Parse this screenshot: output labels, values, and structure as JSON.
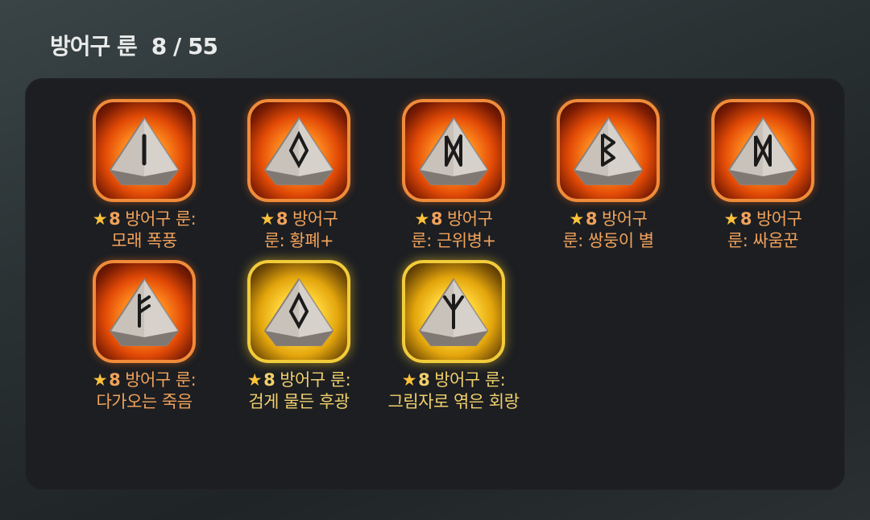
{
  "header": {
    "title": "방어구 룬",
    "count": "8 / 55"
  },
  "runes": [
    {
      "star": "★",
      "grade": "8",
      "name": "방어구 룬:\n모래 폭풍",
      "tier": "orange",
      "glyph": "isa-icon"
    },
    {
      "star": "★",
      "grade": "8",
      "name": "방어구\n룬: 황폐+",
      "tier": "orange",
      "glyph": "othala-icon"
    },
    {
      "star": "★",
      "grade": "8",
      "name": "방어구\n룬: 근위병+",
      "tier": "orange",
      "glyph": "dagaz-icon"
    },
    {
      "star": "★",
      "grade": "8",
      "name": "방어구\n룬: 쌍둥이 별",
      "tier": "orange",
      "glyph": "berkano-icon"
    },
    {
      "star": "★",
      "grade": "8",
      "name": "방어구\n룬: 싸움꾼",
      "tier": "orange",
      "glyph": "dagaz-icon"
    },
    {
      "star": "★",
      "grade": "8",
      "name": "방어구 룬:\n다가오는 죽음",
      "tier": "orange",
      "glyph": "fehu-icon"
    },
    {
      "star": "★",
      "grade": "8",
      "name": "방어구 룬:\n검게 물든 후광",
      "tier": "gold",
      "glyph": "othala-icon"
    },
    {
      "star": "★",
      "grade": "8",
      "name": "방어구 룬:\n그림자로 엮은 회랑",
      "tier": "gold",
      "glyph": "algiz-icon"
    }
  ]
}
